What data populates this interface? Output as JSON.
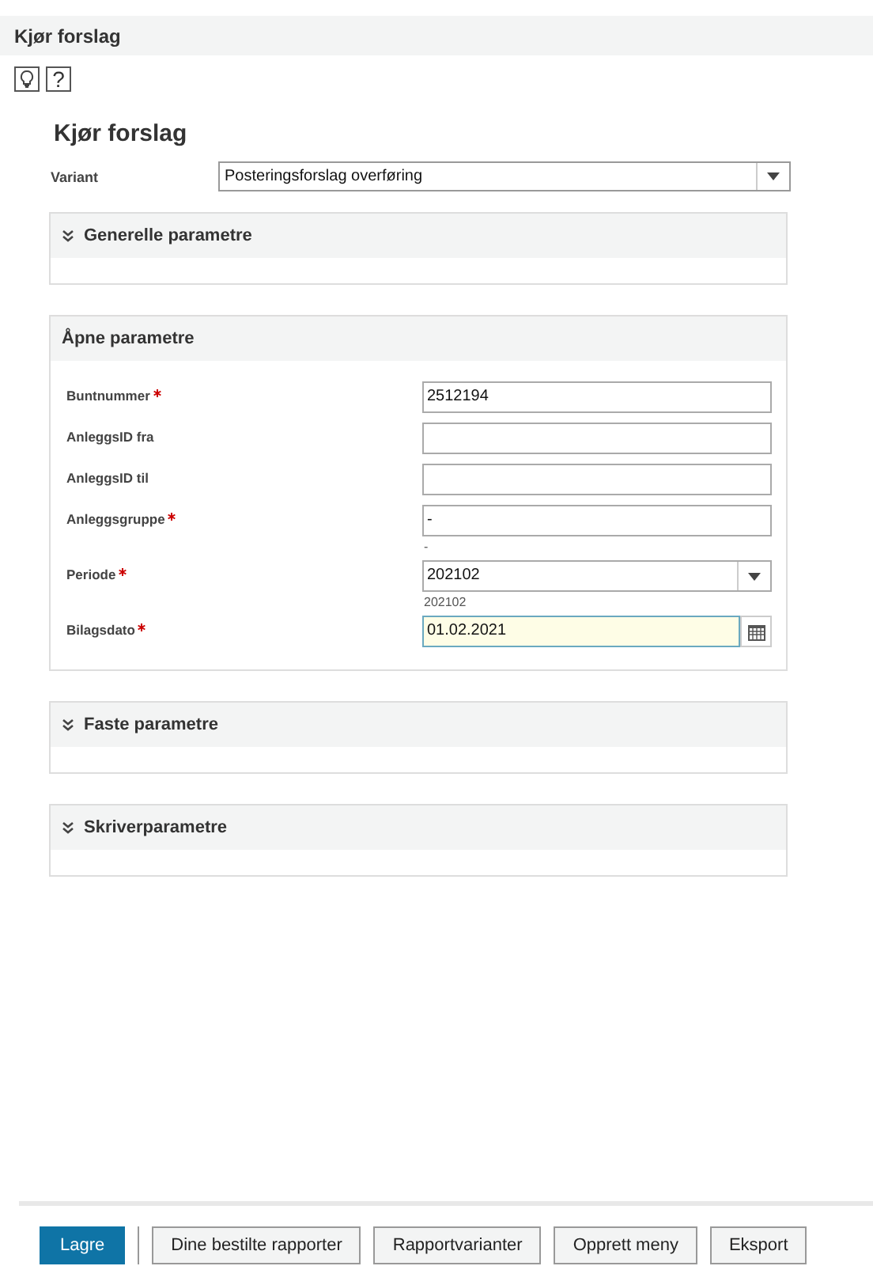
{
  "header": {
    "title": "Kjør forslag"
  },
  "toolbar": [
    {
      "kind": "tip"
    },
    {
      "kind": "help",
      "label": "?"
    }
  ],
  "page_title": "Kjør forslag",
  "variant": {
    "label": "Variant",
    "value": "Posteringsforslag overføring"
  },
  "panels": [
    {
      "title": "Generelle parametre",
      "expanded": false
    },
    {
      "title": "Åpne parametre",
      "expanded": true,
      "fields": [
        {
          "label": "Buntnummer",
          "required": true,
          "kind": "text",
          "value": "2512194",
          "focused": false
        },
        {
          "label": "AnleggsID fra",
          "required": false,
          "kind": "text",
          "focused": false
        },
        {
          "label": "AnleggsID til",
          "required": false,
          "kind": "text",
          "focused": false
        },
        {
          "label": "Anleggsgruppe",
          "required": true,
          "kind": "text",
          "value": "-",
          "hint": "-",
          "focused": false
        },
        {
          "label": "Periode",
          "required": true,
          "kind": "select",
          "value": "202102",
          "hint": "202102",
          "focused": false
        },
        {
          "label": "Bilagsdato",
          "required": true,
          "kind": "date",
          "value": "01.02.2021",
          "focused": true
        }
      ]
    },
    {
      "title": "Faste parametre",
      "expanded": false
    },
    {
      "title": "Skriverparametre",
      "expanded": false
    }
  ],
  "buttons": [
    {
      "label": "Lagre",
      "primary": true
    },
    {
      "label": "Dine bestilte rapporter",
      "primary": false
    },
    {
      "label": "Rapportvarianter",
      "primary": false
    },
    {
      "label": "Opprett meny",
      "primary": false
    },
    {
      "label": "Eksport",
      "primary": false
    }
  ]
}
